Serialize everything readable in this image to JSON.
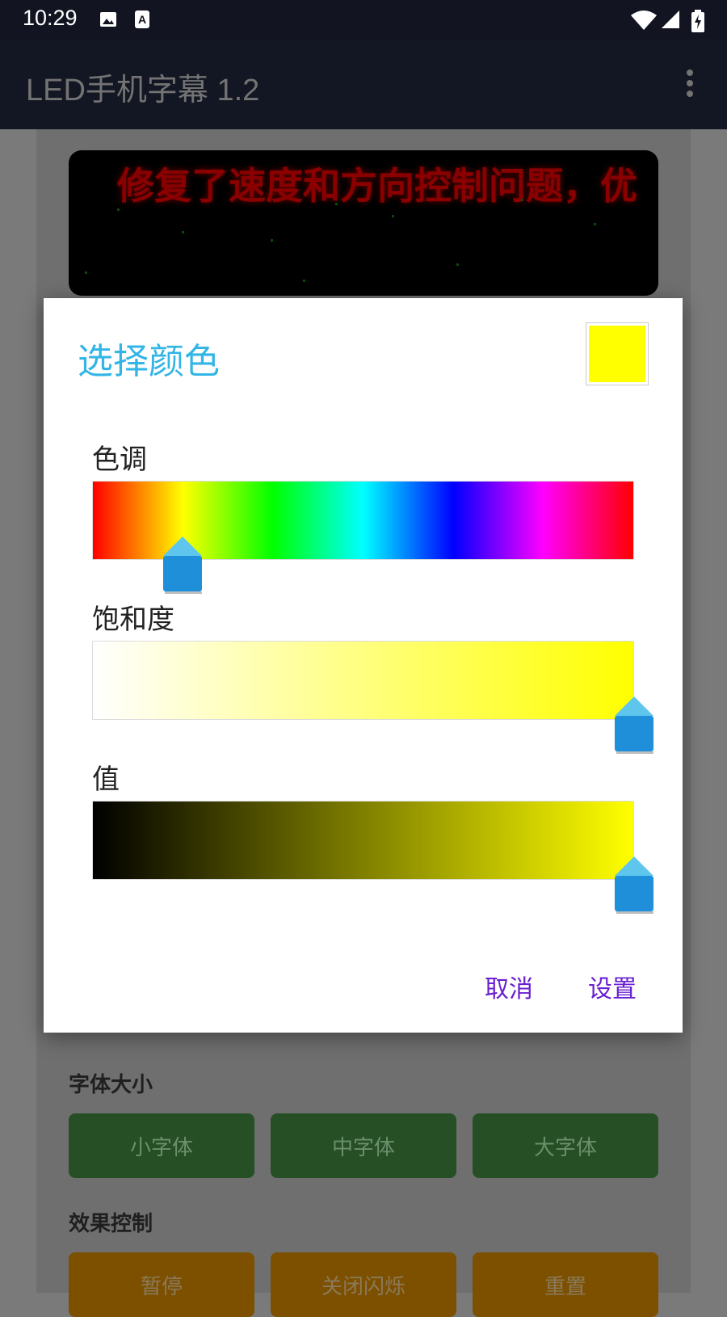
{
  "status_bar": {
    "time": "10:29",
    "icons": [
      "image-icon",
      "a-notification-icon",
      "wifi-icon",
      "signal-icon",
      "battery-charging-icon"
    ]
  },
  "app_bar": {
    "title": "LED手机字幕 1.2",
    "menu_icon": "more-vert-icon"
  },
  "led_display": {
    "text": "修复了速度和方向控制问题，优",
    "text_color": "#8a0000"
  },
  "sections": {
    "font_size": {
      "label": "字体大小",
      "buttons": [
        "小字体",
        "中字体",
        "大字体"
      ]
    },
    "effects": {
      "label": "效果控制",
      "buttons": [
        "暂停",
        "关闭闪烁",
        "重置"
      ]
    }
  },
  "dialog": {
    "title": "选择颜色",
    "selected_color": "#ffff00",
    "hue_label": "色调",
    "saturation_label": "饱和度",
    "value_label": "值",
    "hue_position": 0.167,
    "saturation_position": 1.0,
    "value_position": 1.0,
    "cancel_label": "取消",
    "set_label": "设置"
  },
  "colors": {
    "accent": "#33b5e5",
    "dialog_button": "#6a1fd0",
    "thumb": "#1e8fd8"
  }
}
